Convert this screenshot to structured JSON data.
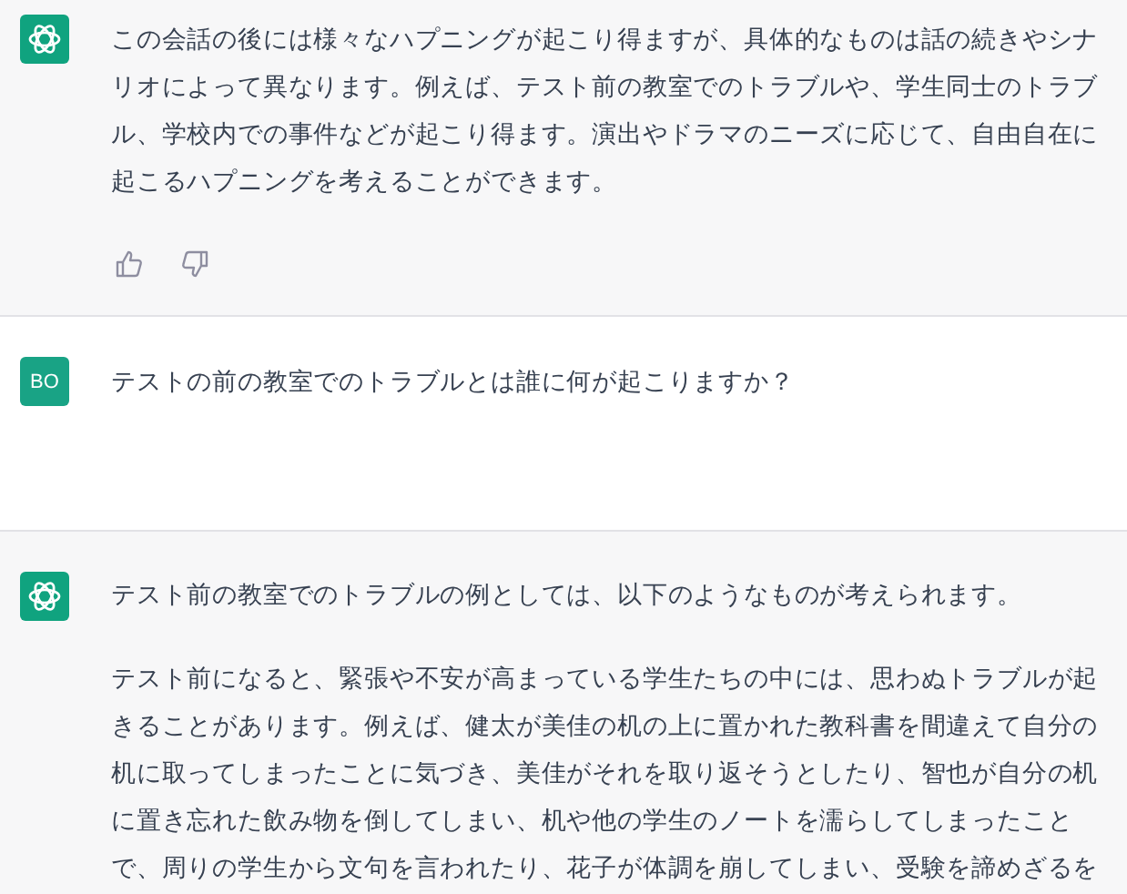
{
  "messages": [
    {
      "kind": "assistant",
      "feedback": true,
      "paragraphs": [
        "この会話の後には様々なハプニングが起こり得ますが、具体的なものは話の続きやシナリオによって異なります。例えば、テスト前の教室でのトラブルや、学生同士のトラブル、学校内での事件などが起こり得ます。演出やドラマのニーズに応じて、自由自在に起こるハプニングを考えることができます。"
      ]
    },
    {
      "kind": "user",
      "avatar": "BO",
      "feedback": false,
      "paragraphs": [
        "テストの前の教室でのトラブルとは誰に何が起こりますか？"
      ]
    },
    {
      "kind": "assistant",
      "feedback": false,
      "paragraphs": [
        "テスト前の教室でのトラブルの例としては、以下のようなものが考えられます。",
        "テスト前になると、緊張や不安が高まっている学生たちの中には、思わぬトラブルが起きることがあります。例えば、健太が美佳の机の上に置かれた教科書を間違えて自分の机に取ってしまったことに気づき、美佳がそれを取り返そうとしたり、智也が自分の机に置き忘れた飲み物を倒してしまい、机や他の学生のノートを濡らしてしまったことで、周りの学生から文句を言われたり、花子が体調を崩してしまい、受験を諦めざるを"
      ]
    }
  ]
}
